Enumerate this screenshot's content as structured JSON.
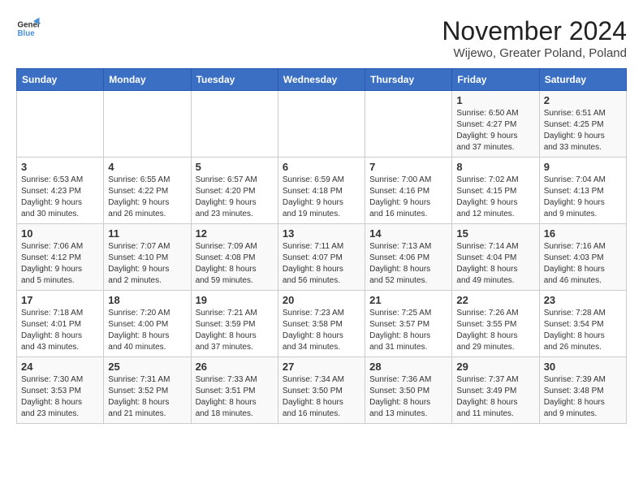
{
  "logo": {
    "line1": "General",
    "line2": "Blue"
  },
  "title": "November 2024",
  "location": "Wijewo, Greater Poland, Poland",
  "weekdays": [
    "Sunday",
    "Monday",
    "Tuesday",
    "Wednesday",
    "Thursday",
    "Friday",
    "Saturday"
  ],
  "weeks": [
    [
      {
        "day": "",
        "info": ""
      },
      {
        "day": "",
        "info": ""
      },
      {
        "day": "",
        "info": ""
      },
      {
        "day": "",
        "info": ""
      },
      {
        "day": "",
        "info": ""
      },
      {
        "day": "1",
        "info": "Sunrise: 6:50 AM\nSunset: 4:27 PM\nDaylight: 9 hours\nand 37 minutes."
      },
      {
        "day": "2",
        "info": "Sunrise: 6:51 AM\nSunset: 4:25 PM\nDaylight: 9 hours\nand 33 minutes."
      }
    ],
    [
      {
        "day": "3",
        "info": "Sunrise: 6:53 AM\nSunset: 4:23 PM\nDaylight: 9 hours\nand 30 minutes."
      },
      {
        "day": "4",
        "info": "Sunrise: 6:55 AM\nSunset: 4:22 PM\nDaylight: 9 hours\nand 26 minutes."
      },
      {
        "day": "5",
        "info": "Sunrise: 6:57 AM\nSunset: 4:20 PM\nDaylight: 9 hours\nand 23 minutes."
      },
      {
        "day": "6",
        "info": "Sunrise: 6:59 AM\nSunset: 4:18 PM\nDaylight: 9 hours\nand 19 minutes."
      },
      {
        "day": "7",
        "info": "Sunrise: 7:00 AM\nSunset: 4:16 PM\nDaylight: 9 hours\nand 16 minutes."
      },
      {
        "day": "8",
        "info": "Sunrise: 7:02 AM\nSunset: 4:15 PM\nDaylight: 9 hours\nand 12 minutes."
      },
      {
        "day": "9",
        "info": "Sunrise: 7:04 AM\nSunset: 4:13 PM\nDaylight: 9 hours\nand 9 minutes."
      }
    ],
    [
      {
        "day": "10",
        "info": "Sunrise: 7:06 AM\nSunset: 4:12 PM\nDaylight: 9 hours\nand 5 minutes."
      },
      {
        "day": "11",
        "info": "Sunrise: 7:07 AM\nSunset: 4:10 PM\nDaylight: 9 hours\nand 2 minutes."
      },
      {
        "day": "12",
        "info": "Sunrise: 7:09 AM\nSunset: 4:08 PM\nDaylight: 8 hours\nand 59 minutes."
      },
      {
        "day": "13",
        "info": "Sunrise: 7:11 AM\nSunset: 4:07 PM\nDaylight: 8 hours\nand 56 minutes."
      },
      {
        "day": "14",
        "info": "Sunrise: 7:13 AM\nSunset: 4:06 PM\nDaylight: 8 hours\nand 52 minutes."
      },
      {
        "day": "15",
        "info": "Sunrise: 7:14 AM\nSunset: 4:04 PM\nDaylight: 8 hours\nand 49 minutes."
      },
      {
        "day": "16",
        "info": "Sunrise: 7:16 AM\nSunset: 4:03 PM\nDaylight: 8 hours\nand 46 minutes."
      }
    ],
    [
      {
        "day": "17",
        "info": "Sunrise: 7:18 AM\nSunset: 4:01 PM\nDaylight: 8 hours\nand 43 minutes."
      },
      {
        "day": "18",
        "info": "Sunrise: 7:20 AM\nSunset: 4:00 PM\nDaylight: 8 hours\nand 40 minutes."
      },
      {
        "day": "19",
        "info": "Sunrise: 7:21 AM\nSunset: 3:59 PM\nDaylight: 8 hours\nand 37 minutes."
      },
      {
        "day": "20",
        "info": "Sunrise: 7:23 AM\nSunset: 3:58 PM\nDaylight: 8 hours\nand 34 minutes."
      },
      {
        "day": "21",
        "info": "Sunrise: 7:25 AM\nSunset: 3:57 PM\nDaylight: 8 hours\nand 31 minutes."
      },
      {
        "day": "22",
        "info": "Sunrise: 7:26 AM\nSunset: 3:55 PM\nDaylight: 8 hours\nand 29 minutes."
      },
      {
        "day": "23",
        "info": "Sunrise: 7:28 AM\nSunset: 3:54 PM\nDaylight: 8 hours\nand 26 minutes."
      }
    ],
    [
      {
        "day": "24",
        "info": "Sunrise: 7:30 AM\nSunset: 3:53 PM\nDaylight: 8 hours\nand 23 minutes."
      },
      {
        "day": "25",
        "info": "Sunrise: 7:31 AM\nSunset: 3:52 PM\nDaylight: 8 hours\nand 21 minutes."
      },
      {
        "day": "26",
        "info": "Sunrise: 7:33 AM\nSunset: 3:51 PM\nDaylight: 8 hours\nand 18 minutes."
      },
      {
        "day": "27",
        "info": "Sunrise: 7:34 AM\nSunset: 3:50 PM\nDaylight: 8 hours\nand 16 minutes."
      },
      {
        "day": "28",
        "info": "Sunrise: 7:36 AM\nSunset: 3:50 PM\nDaylight: 8 hours\nand 13 minutes."
      },
      {
        "day": "29",
        "info": "Sunrise: 7:37 AM\nSunset: 3:49 PM\nDaylight: 8 hours\nand 11 minutes."
      },
      {
        "day": "30",
        "info": "Sunrise: 7:39 AM\nSunset: 3:48 PM\nDaylight: 8 hours\nand 9 minutes."
      }
    ]
  ]
}
